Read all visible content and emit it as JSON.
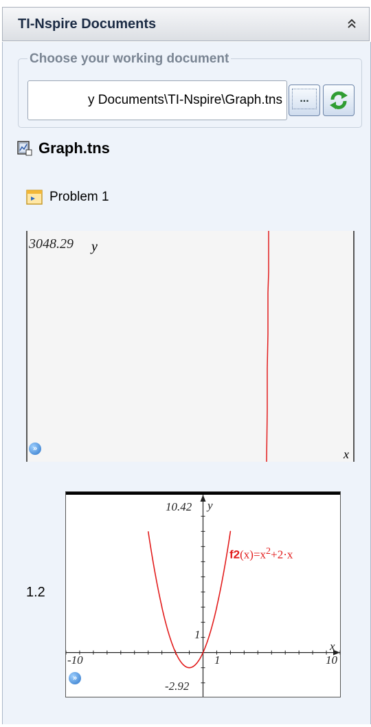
{
  "panel": {
    "title": "TI-Nspire Documents"
  },
  "working_document": {
    "legend": "Choose your working document",
    "path_value": "y Documents\\TI-Nspire\\Graph.tns",
    "browse_label": "..."
  },
  "tree": {
    "document_name": "Graph.tns",
    "problem_name": "Problem 1"
  },
  "page_1_1": {
    "y_max": "3048.29",
    "y_label": "y",
    "x_label": "x"
  },
  "page_1_2": {
    "page_number": "1.2",
    "y_max": "10.42",
    "y_min": "-2.92",
    "x_min": "-10",
    "x_max": "10",
    "x_tick": "1",
    "y_tick": "1",
    "y_label": "y",
    "x_label": "x",
    "function_name": "f2",
    "function_arg": "(x)=x",
    "function_exp": "2",
    "function_rest": "+2·x",
    "function_color": "#e21b1b"
  },
  "chart_data": {
    "type": "line",
    "series": [
      {
        "name": "f2(x)=x^2+2·x",
        "x": [
          -3.5,
          -3,
          -2,
          -1,
          0,
          1,
          2
        ],
        "y": [
          5.25,
          3,
          0,
          -1,
          0,
          3,
          8
        ]
      }
    ],
    "xlim": [
      -10,
      10
    ],
    "ylim": [
      -2.92,
      10.42
    ],
    "xlabel": "x",
    "ylabel": "y"
  },
  "icons": {
    "collapse": "double-chevron-up-icon",
    "refresh": "refresh-icon",
    "document": "document-icon",
    "problem": "problem-icon",
    "expand": "expand-icon"
  },
  "colors": {
    "accent": "#2c74c8",
    "graph": "#e21b1b",
    "panel_background": "#eef3fa"
  }
}
